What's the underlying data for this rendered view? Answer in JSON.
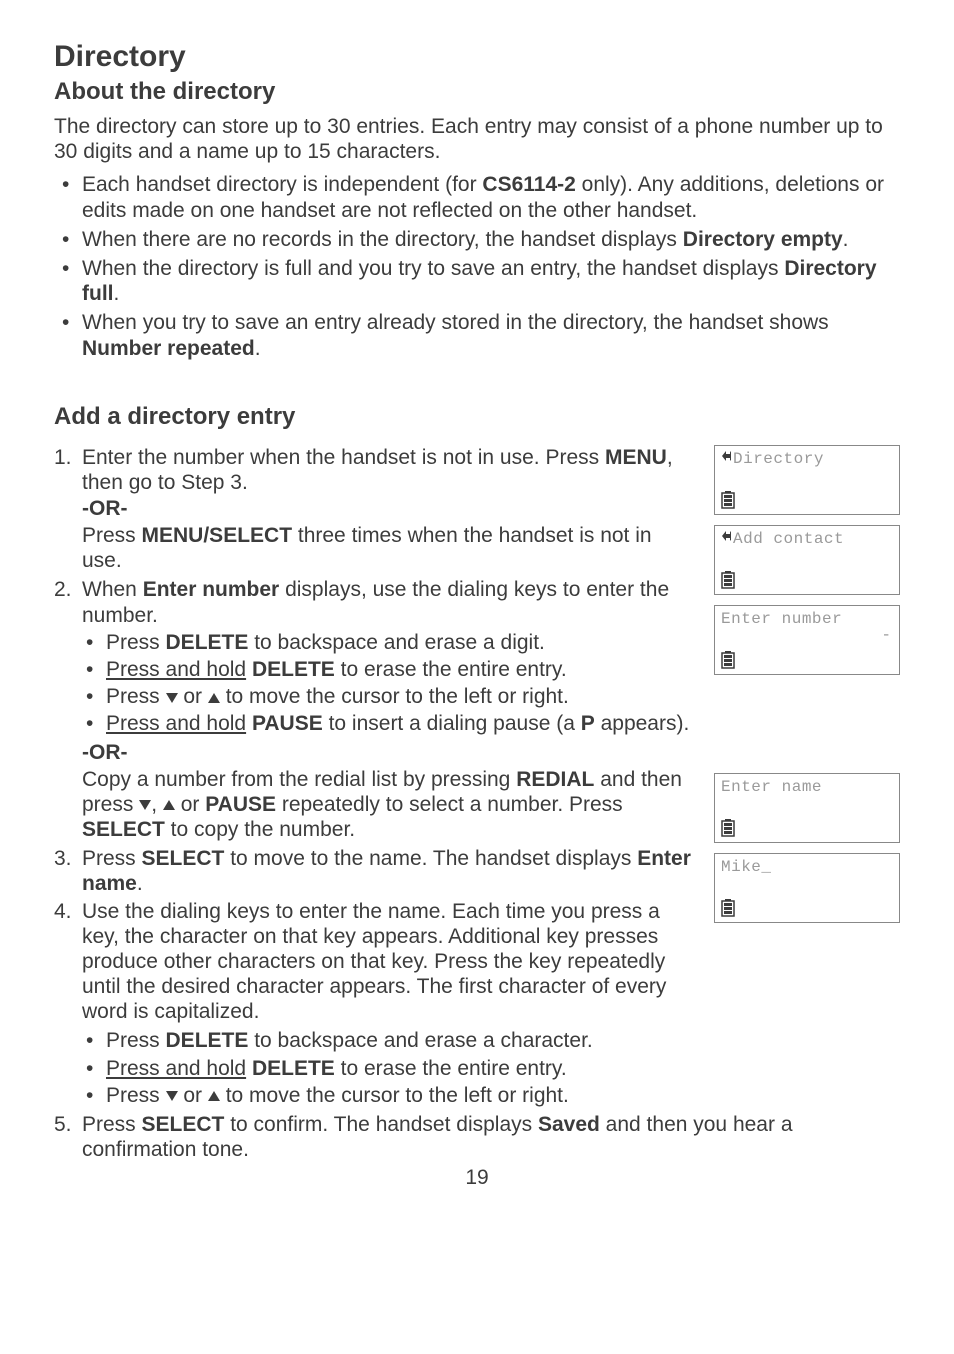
{
  "page_title": "Directory",
  "section1_heading": "About the directory",
  "section1_intro": "The directory can store up to 30 entries. Each entry may consist of a phone number up to 30 digits and a name up to 15 characters.",
  "top_bullets": {
    "b1_pre": "Each handset directory is independent (for ",
    "b1_bold": "CS6114-2",
    "b1_post": " only). Any additions, deletions or edits made on one handset are not reflected on the other handset.",
    "b2_pre": "When there are no records in the directory, the handset displays ",
    "b2_bold": "Directory empty",
    "b2_post": ".",
    "b3_pre": "When the directory is full and you try to save an entry, the handset displays ",
    "b3_bold": "Directory full",
    "b3_post": ".",
    "b4_pre": "When you try to save an entry already stored in the directory, the handset shows ",
    "b4_bold": "Number repeated",
    "b4_post": "."
  },
  "section2_heading": "Add a directory entry",
  "steps": {
    "s1_num": "1.",
    "s1_pre": "Enter the number when the handset is not in use. Press ",
    "s1_bold": "MENU",
    "s1_post": ", then go to Step 3.",
    "or": "-OR-",
    "s1b_pre": "Press ",
    "s1b_bold": "MENU/SELECT",
    "s1b_post": " three times when the handset is not in use.",
    "s2_num": "2.",
    "s2_pre": "When ",
    "s2_bold": "Enter number",
    "s2_post": " displays, use the dialing keys to enter the number.",
    "s2_sub": {
      "a_pre": "Press ",
      "a_bold": "DELETE",
      "a_post": " to backspace and erase a digit.",
      "b_u": "Press and hold",
      "b_sp": " ",
      "b_bold": "DELETE",
      "b_post": " to erase the entire entry.",
      "c_pre": "Press ",
      "c_mid": " or ",
      "c_post": " to move the cursor to the left or right.",
      "d_u": "Press and hold",
      "d_sp": " ",
      "d_bold": "PAUSE",
      "d_post1": " to insert a dialing pause (a ",
      "d_bold2": "P",
      "d_post2": " appears)."
    },
    "s2b_pre": "Copy a number from the redial list by pressing ",
    "s2b_bold": "REDIAL",
    "s2b_mid1": " and then press ",
    "s2b_comma": ", ",
    "s2b_mid2": " or ",
    "s2b_bold2": "PAUSE",
    "s2b_mid3": " repeatedly to select a number. Press ",
    "s2b_bold3": "SELECT",
    "s2b_post": " to copy the number.",
    "s3_num": "3.",
    "s3_pre": "Press ",
    "s3_bold": "SELECT",
    "s3_mid": " to move to the name. The handset displays ",
    "s3_bold2": "Enter name",
    "s3_post": ".",
    "s4_num": "4.",
    "s4_text": "Use the dialing keys to enter the name. Each time you press a key, the character on that key appears. Additional key presses produce other characters on that key. Press the key repeatedly until the desired character appears. The first character of every word is capitalized.",
    "s4_sub": {
      "a_pre": "Press ",
      "a_bold": "DELETE",
      "a_post": " to backspace and erase a character.",
      "b_u": "Press and hold",
      "b_sp": " ",
      "b_bold": "DELETE",
      "b_post": " to erase the entire entry.",
      "c_pre": "Press ",
      "c_mid": " or ",
      "c_post": " to move the cursor to the left or right."
    },
    "s5_num": "5.",
    "s5_pre": "Press ",
    "s5_bold": "SELECT",
    "s5_mid": " to confirm. The handset displays ",
    "s5_bold2": "Saved",
    "s5_post": " and then you hear a confirmation tone."
  },
  "lcd": {
    "l1": "Directory",
    "l2": "Add contact",
    "l3a": "Enter number",
    "l3b": "-",
    "l4": "Enter name",
    "l5": "Mike_"
  },
  "page_number": "19"
}
